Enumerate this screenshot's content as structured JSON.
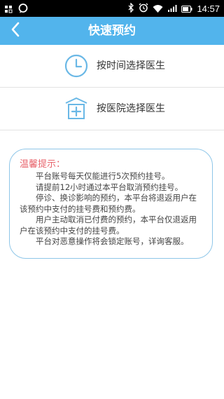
{
  "status_bar": {
    "time": "14:57",
    "left_icons": [
      "gallery-icon",
      "message-bubble-icon"
    ],
    "right_icons": [
      "bluetooth-icon",
      "alarm-icon",
      "wifi-icon",
      "signal-icon",
      "battery-icon"
    ]
  },
  "header": {
    "title": "快速预约",
    "back_icon": "chevron-left-icon",
    "background": "#52b4ec"
  },
  "options": [
    {
      "icon": "clock-icon",
      "label": "按时间选择医生"
    },
    {
      "icon": "hospital-icon",
      "label": "按医院选择医生"
    }
  ],
  "notice": {
    "title": "温馨提示：",
    "title_color": "#e8636b",
    "lines": [
      "平台账号每天仅能进行5次预约挂号。",
      "请提前12小时通过本平台取消预约挂号。",
      "停诊、换诊影响的预约，本平台将退返用户在该预约中支付的挂号费和预约费。",
      "用户主动取消已付费的预约，本平台仅退返用户在该预约中支付的挂号费。",
      "平台对恶意操作将会锁定账号，详询客服。"
    ]
  }
}
